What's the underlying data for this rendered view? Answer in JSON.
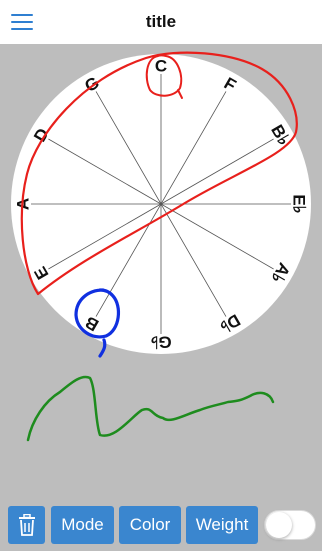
{
  "header": {
    "title": "title",
    "menu_icon": "hamburger-menu-icon"
  },
  "wheel": {
    "labels": [
      "C",
      "F",
      "B♭",
      "E♭",
      "A♭",
      "D♭",
      "G♭",
      "B",
      "E",
      "A",
      "D",
      "G"
    ]
  },
  "toolbar": {
    "delete_icon": "trash-icon",
    "mode_label": "Mode",
    "color_label": "Color",
    "weight_label": "Weight",
    "toggle_on": false
  },
  "colors": {
    "accent": "#3a86cf",
    "canvas_bg": "#bdbdbd",
    "stroke_red": "#e8201c",
    "stroke_blue": "#1030e0",
    "stroke_green": "#1e8c1e"
  }
}
